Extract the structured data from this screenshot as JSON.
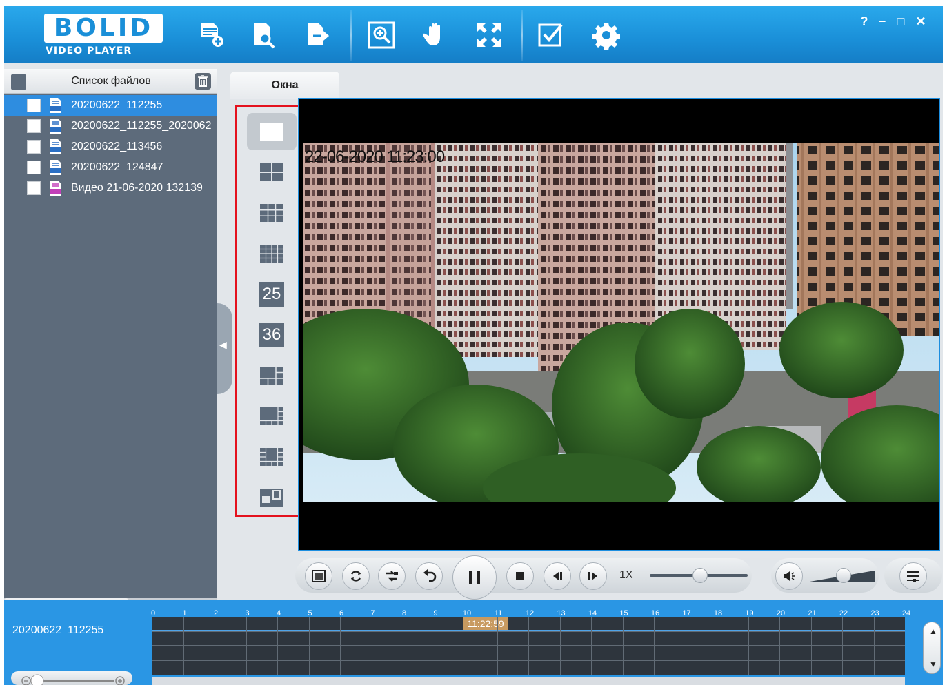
{
  "app": {
    "logo_word": "BOLID",
    "logo_sub": "VIDEO PLAYER"
  },
  "toolbar": {
    "buttons": [
      "open-file",
      "search-file",
      "export",
      "zoom",
      "pan",
      "fullscreen",
      "select-check",
      "settings"
    ]
  },
  "window_controls": {
    "help": "?",
    "minimize": "−",
    "maximize": "□",
    "close": "✕"
  },
  "file_panel": {
    "title": "Список файлов",
    "files": [
      {
        "name": "20200622_112255",
        "type": "dav",
        "selected": true
      },
      {
        "name": "20200622_112255_2020062",
        "type": "dav",
        "selected": false
      },
      {
        "name": "20200622_113456",
        "type": "dav",
        "selected": false
      },
      {
        "name": "20200622_124847",
        "type": "dav",
        "selected": false
      },
      {
        "name": "Видео 21-06-2020 132139",
        "type": "mp4",
        "selected": false
      }
    ]
  },
  "tabs": {
    "windows": "Окна"
  },
  "layouts": [
    {
      "id": "1x1",
      "label": ""
    },
    {
      "id": "2x2",
      "label": ""
    },
    {
      "id": "3x3",
      "label": ""
    },
    {
      "id": "4x4",
      "label": ""
    },
    {
      "id": "5x5",
      "label": "25"
    },
    {
      "id": "6x6",
      "label": "36"
    },
    {
      "id": "1+5",
      "label": ""
    },
    {
      "id": "1+7",
      "label": ""
    },
    {
      "id": "1+12",
      "label": ""
    },
    {
      "id": "custom",
      "label": ""
    }
  ],
  "video": {
    "osd_timestamp": "22-06-2020 11:23:00"
  },
  "controls": {
    "speed": "1X",
    "speed_level": 0.5,
    "volume_level": 0.6
  },
  "timeline": {
    "file_name": "20200622_112255",
    "hour_labels": [
      "0",
      "1",
      "2",
      "3",
      "4",
      "5",
      "6",
      "7",
      "8",
      "9",
      "10",
      "11",
      "12",
      "13",
      "14",
      "15",
      "16",
      "17",
      "18",
      "19",
      "20",
      "21",
      "22",
      "23",
      "24"
    ],
    "cursor_time": "11:22:59"
  },
  "colors": {
    "accent": "#1a8fd8",
    "selection": "#2e8de0",
    "highlight_box": "#e4121e"
  }
}
